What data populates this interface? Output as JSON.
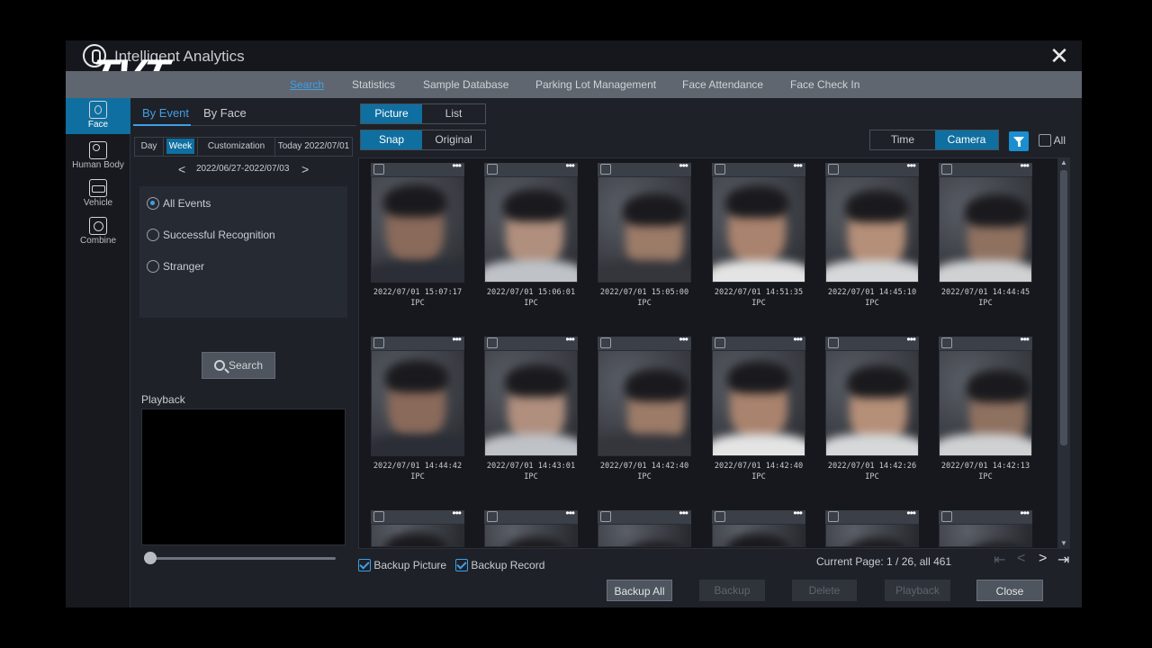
{
  "app": {
    "brand": "TVT",
    "title": "Intelligent Analytics",
    "close_symbol": "✕"
  },
  "topnav": {
    "tabs": [
      {
        "label": "Search",
        "active": true
      },
      {
        "label": "Statistics"
      },
      {
        "label": "Sample Database"
      },
      {
        "label": "Parking Lot Management"
      },
      {
        "label": "Face Attendance"
      },
      {
        "label": "Face Check In"
      }
    ]
  },
  "sidebar": {
    "items": [
      {
        "label": "Face",
        "icon": "face-icon",
        "active": true
      },
      {
        "label": "Human Body",
        "icon": "human-body-icon"
      },
      {
        "label": "Vehicle",
        "icon": "vehicle-icon"
      },
      {
        "label": "Combine",
        "icon": "combine-icon"
      }
    ]
  },
  "left_panel": {
    "subtabs": [
      "By Event",
      "By Face"
    ],
    "range_tabs": [
      "Day",
      "Week",
      "Customization",
      "Today 2022/07/01"
    ],
    "range_active": "Week",
    "date_range": "2022/06/27-2022/07/03",
    "prev_symbol": "<",
    "next_symbol": ">",
    "events": [
      "All Events",
      "Successful Recognition",
      "Stranger"
    ],
    "event_selected": "All Events",
    "search_button": "Search",
    "playback_label": "Playback",
    "playback_position": 0
  },
  "main": {
    "view_toggle": [
      "Picture",
      "List"
    ],
    "view_active": "Picture",
    "image_toggle": [
      "Snap",
      "Original"
    ],
    "image_active": "Snap",
    "sort_toggle": [
      "Time",
      "Camera"
    ],
    "sort_active": "Camera",
    "all_label": "All",
    "all_checked": false,
    "more_symbol": "•••",
    "cards": [
      {
        "time": "2022/07/01 15:07:17",
        "source": "IPC"
      },
      {
        "time": "2022/07/01 15:06:01",
        "source": "IPC"
      },
      {
        "time": "2022/07/01 15:05:00",
        "source": "IPC"
      },
      {
        "time": "2022/07/01 14:51:35",
        "source": "IPC"
      },
      {
        "time": "2022/07/01 14:45:10",
        "source": "IPC"
      },
      {
        "time": "2022/07/01 14:44:45",
        "source": "IPC"
      },
      {
        "time": "2022/07/01 14:44:42",
        "source": "IPC"
      },
      {
        "time": "2022/07/01 14:43:01",
        "source": "IPC"
      },
      {
        "time": "2022/07/01 14:42:40",
        "source": "IPC"
      },
      {
        "time": "2022/07/01 14:42:40",
        "source": "IPC"
      },
      {
        "time": "2022/07/01 14:42:26",
        "source": "IPC"
      },
      {
        "time": "2022/07/01 14:42:13",
        "source": "IPC"
      }
    ],
    "partial_cards": 6,
    "backup_picture": {
      "label": "Backup Picture",
      "checked": true
    },
    "backup_record": {
      "label": "Backup Record",
      "checked": true
    },
    "page_info": "Current Page: 1 / 26, all 461",
    "pager_symbols": [
      "⇤",
      "<",
      ">",
      "⇥"
    ],
    "buttons": [
      {
        "label": "Backup All",
        "enabled": true
      },
      {
        "label": "Backup",
        "enabled": false
      },
      {
        "label": "Delete",
        "enabled": false
      },
      {
        "label": "Playback",
        "enabled": false
      },
      {
        "label": "Close",
        "enabled": true
      }
    ]
  },
  "colors": {
    "accent": "#0f6fa0",
    "link": "#3e9fe8",
    "filter": "#1a8ed0",
    "background": "#1e2128"
  }
}
